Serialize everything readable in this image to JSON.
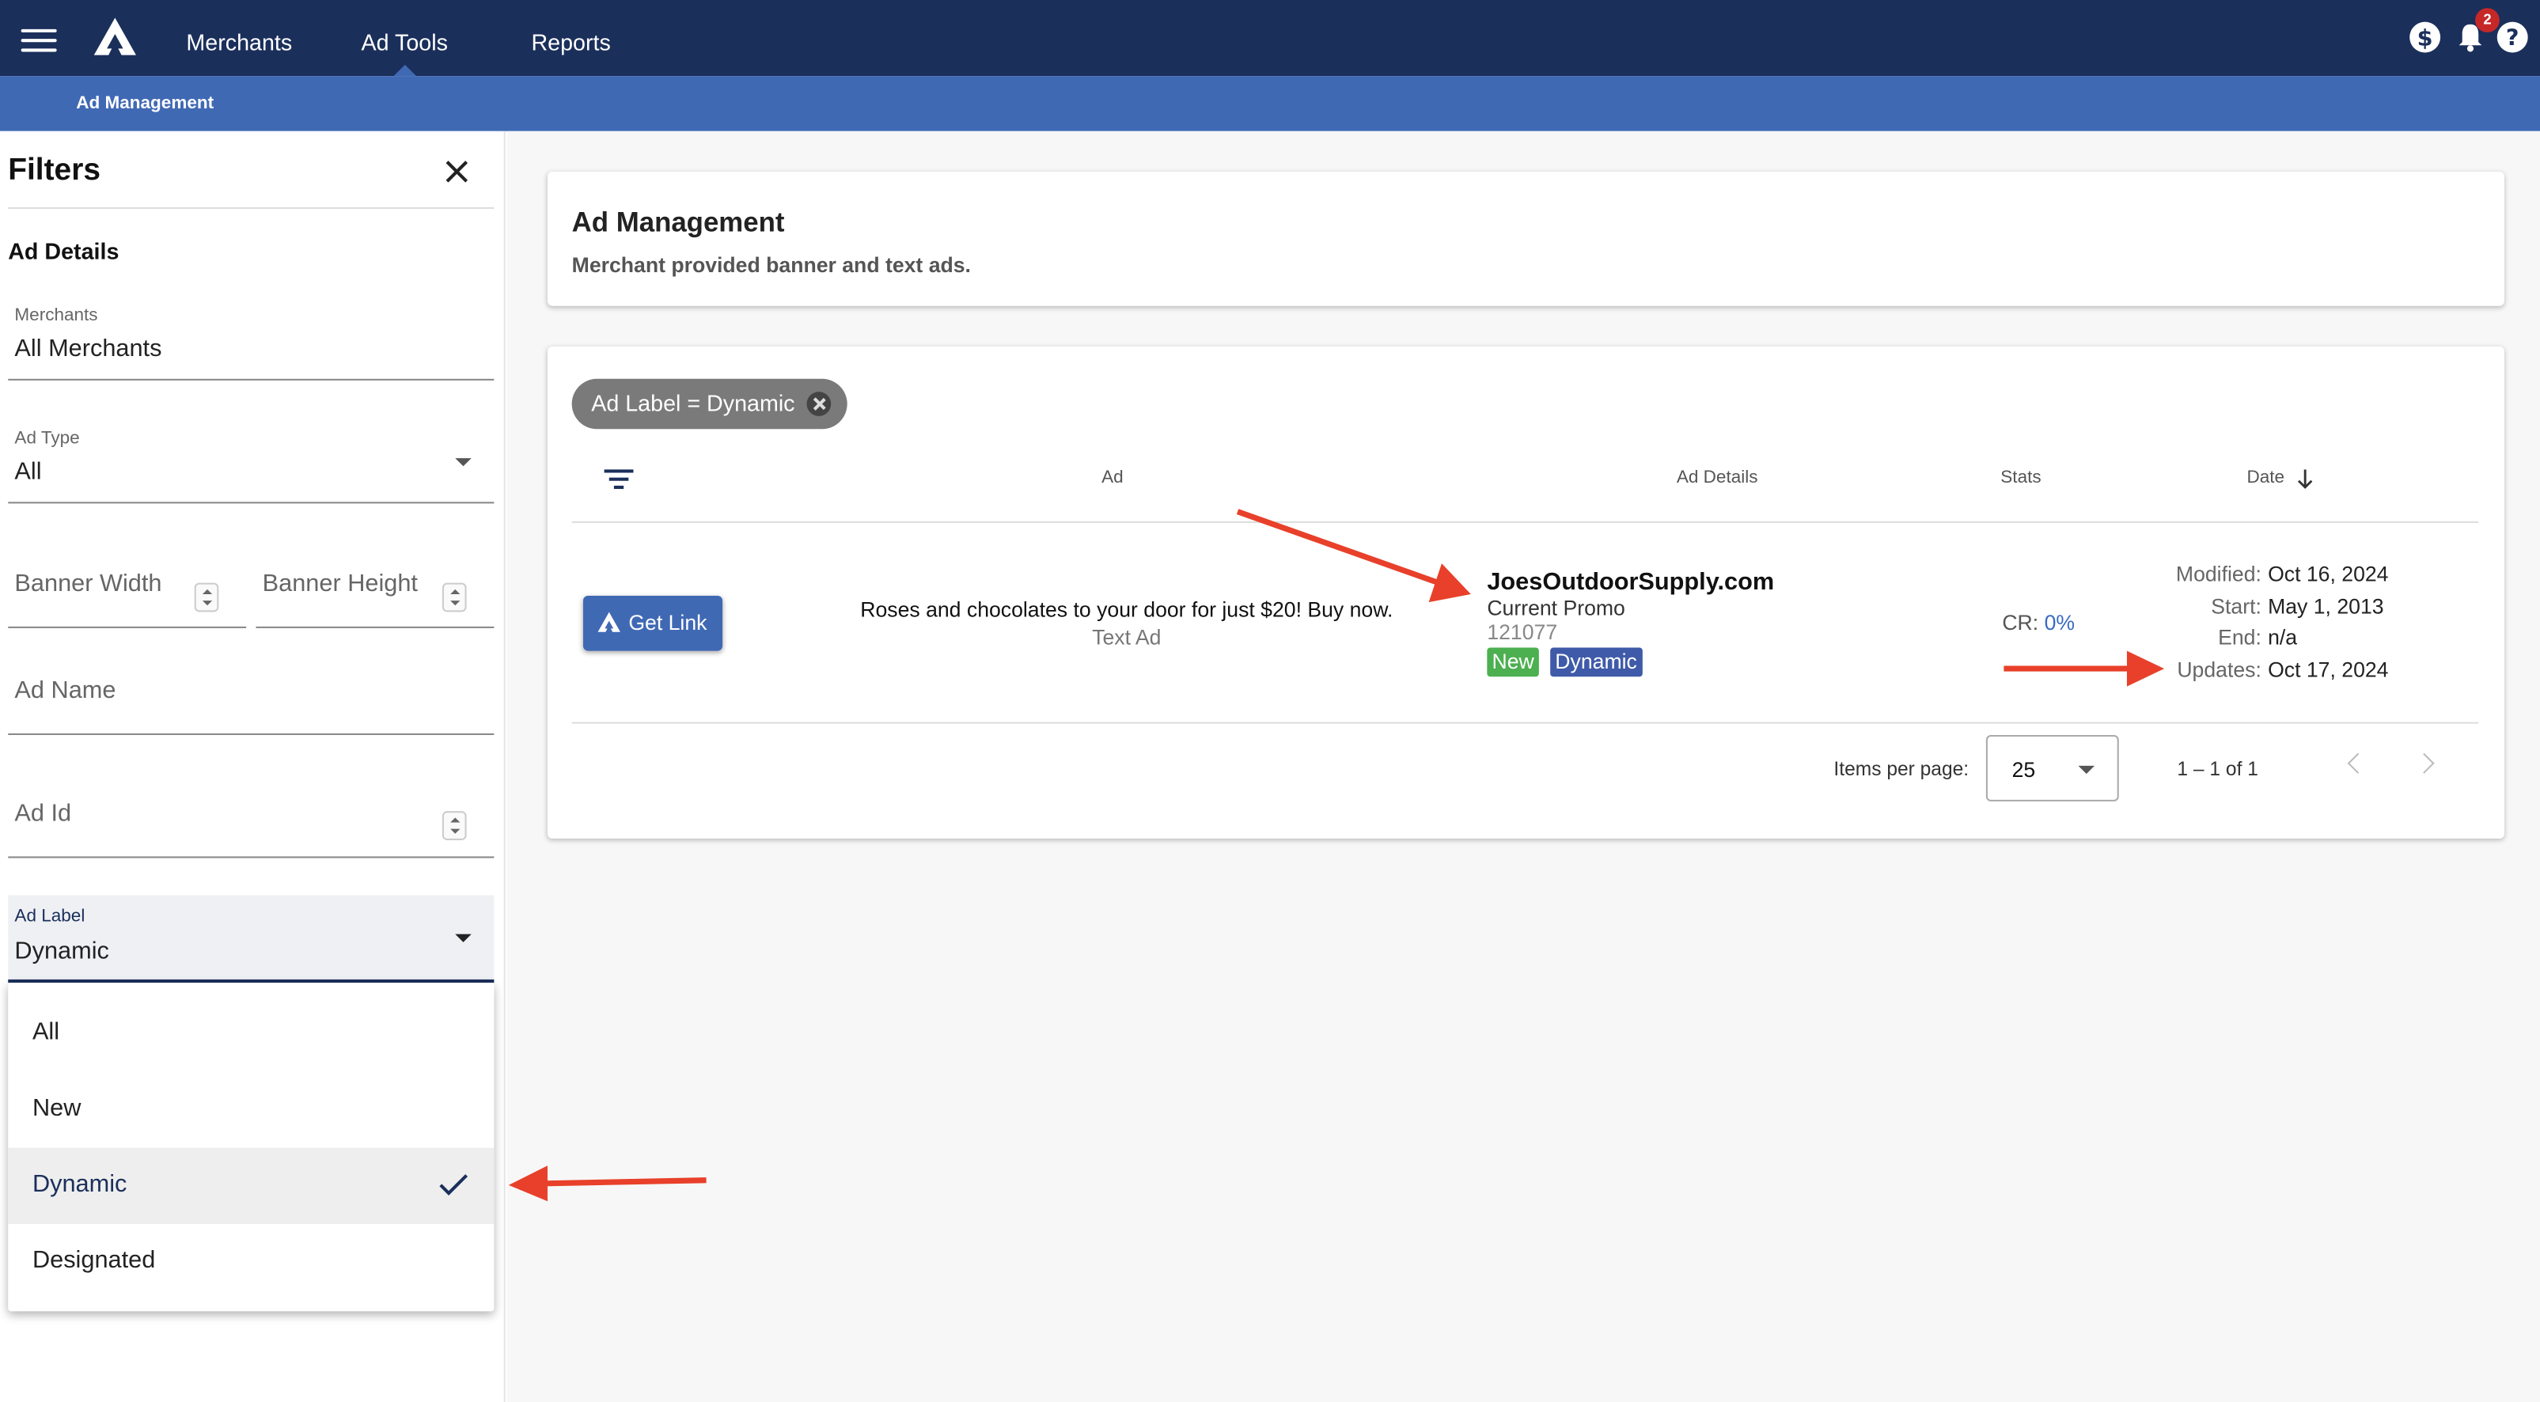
{
  "topbar": {
    "nav": [
      "Merchants",
      "Ad Tools",
      "Reports"
    ],
    "active_nav": "Ad Tools",
    "notification_count": "2",
    "icons": [
      "menu-icon",
      "logo-icon",
      "dollar-icon",
      "bell-icon",
      "help-icon"
    ]
  },
  "subnav": {
    "active": "Ad Management"
  },
  "filters": {
    "title": "Filters",
    "section": "Ad Details",
    "merchants": {
      "label": "Merchants",
      "value": "All Merchants"
    },
    "ad_type": {
      "label": "Ad Type",
      "value": "All"
    },
    "banner_width": {
      "placeholder": "Banner Width"
    },
    "banner_height": {
      "placeholder": "Banner Height"
    },
    "ad_name": {
      "placeholder": "Ad Name"
    },
    "ad_id": {
      "placeholder": "Ad Id"
    },
    "ad_label": {
      "label": "Ad Label",
      "value": "Dynamic"
    },
    "ad_label_options": [
      "All",
      "New",
      "Dynamic",
      "Designated"
    ],
    "ad_label_selected": "Dynamic"
  },
  "header_card": {
    "title": "Ad Management",
    "subtitle": "Merchant provided banner and text ads."
  },
  "table": {
    "chip": "Ad Label = Dynamic",
    "columns": [
      "Ad",
      "Ad Details",
      "Stats",
      "Date"
    ],
    "sort_column": "Date",
    "rows": [
      {
        "button": "Get Link",
        "ad_text": "Roses and chocolates to your door for just $20! Buy now.",
        "ad_type": "Text Ad",
        "merchant": "JoesOutdoorSupply.com",
        "promo": "Current Promo",
        "ad_id": "121077",
        "tags": [
          "New",
          "Dynamic"
        ],
        "stats": {
          "label": "CR:",
          "value": "0%"
        },
        "dates": [
          {
            "label": "Modified:",
            "value": "Oct 16, 2024"
          },
          {
            "label": "Start:",
            "value": "May 1, 2013"
          },
          {
            "label": "End:",
            "value": "n/a"
          },
          {
            "label": "Updates:",
            "value": "Oct 17, 2024"
          }
        ]
      }
    ]
  },
  "pager": {
    "label": "Items per page:",
    "value": "25",
    "range": "1 – 1 of 1"
  },
  "colors": {
    "topbar": "#1b2f5b",
    "subbar": "#4069b4",
    "tag_new": "#4caf50",
    "tag_dynamic": "#3f5aa8",
    "arrow": "#e8402a"
  }
}
